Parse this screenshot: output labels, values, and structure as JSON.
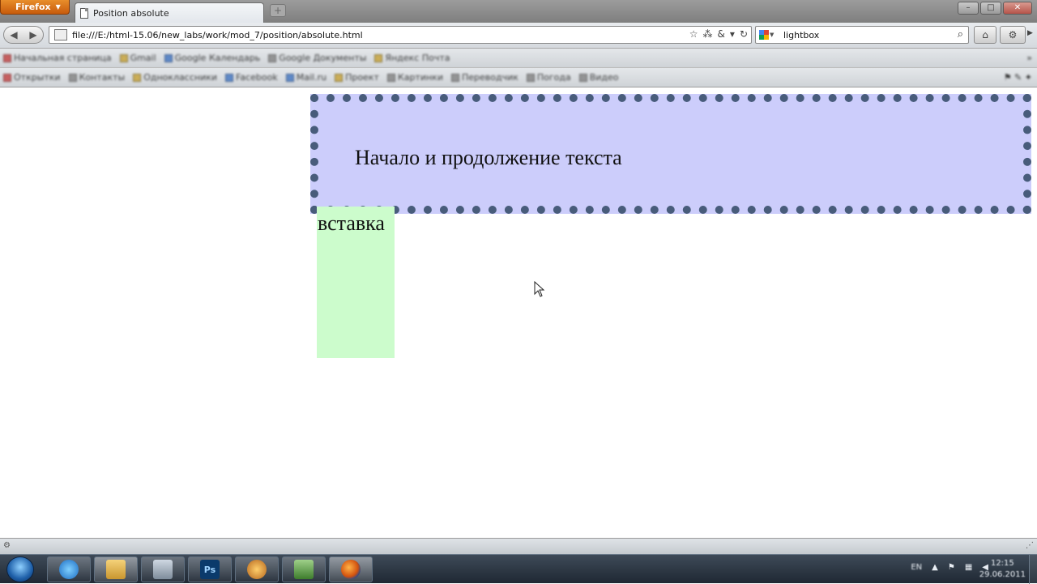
{
  "browser": {
    "app_button_label": "Firefox",
    "tab_title": "Position absolute",
    "url": "file:///E:/html-15.06/new_labs/work/mod_7/position/absolute.html",
    "search_value": "lightbox"
  },
  "bookmarks_row1": [
    {
      "label": "Начальная страница"
    },
    {
      "label": "Gmail"
    },
    {
      "label": "Google Календарь"
    },
    {
      "label": "Google Документы"
    },
    {
      "label": "Яндекс Почта"
    }
  ],
  "bookmarks_row2": [
    {
      "label": "Открытки"
    },
    {
      "label": "Контакты"
    },
    {
      "label": "Одноклассники"
    },
    {
      "label": "Facebook"
    },
    {
      "label": "Mail.ru"
    },
    {
      "label": "Проект"
    },
    {
      "label": "Картинки"
    },
    {
      "label": "Переводчик"
    },
    {
      "label": "Погода"
    },
    {
      "label": "Видео"
    }
  ],
  "page": {
    "absolute_box_text": "Начало и продолжение текста",
    "insert_box_text": "вставка",
    "colors": {
      "absolute_box_bg": "#cccdfb",
      "absolute_box_border": "#485c7b",
      "insert_box_bg": "#ccfccc"
    }
  },
  "taskbar": {
    "tray_language": "EN",
    "clock_time": "12:15",
    "clock_date": "29.06.2011"
  }
}
